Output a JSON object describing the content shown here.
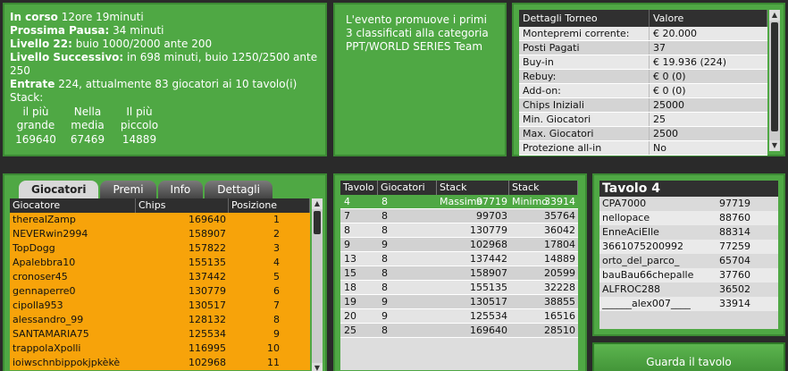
{
  "info": {
    "in_corso_label": "In corso",
    "in_corso_value": "12ore 19minuti",
    "pausa_label": "Prossima Pausa:",
    "pausa_value": "34 minuti",
    "livello_label": "Livello 22:",
    "livello_value": "buio 1000/2000 ante 200",
    "successivo_label": "Livello Successivo:",
    "successivo_value": "in 698 minuti, buio 1250/2500 ante 250",
    "entrate_label": "Entrate",
    "entrate_value": "224, attualmente 83 giocatori ai 10 tavolo(i)",
    "stack_label": "Stack:",
    "stacks": [
      {
        "l1": "il più",
        "l2": "grande",
        "value": "169640"
      },
      {
        "l1": "Nella",
        "l2": "media",
        "value": "67469"
      },
      {
        "l1": "Il più",
        "l2": "piccolo",
        "value": "14889"
      }
    ]
  },
  "promo": {
    "text": "L'evento promuove i primi 3 classificati alla categoria PPT/WORLD SERIES Team"
  },
  "details": {
    "headers": [
      "Dettagli Torneo",
      "Valore"
    ],
    "rows": [
      [
        "Montepremi corrente:",
        "€ 20.000"
      ],
      [
        "Posti Pagati",
        "37"
      ],
      [
        "Buy-in",
        "€ 19.936 (224)"
      ],
      [
        "Rebuy:",
        "€ 0 (0)"
      ],
      [
        "Add-on:",
        "€ 0 (0)"
      ],
      [
        "Chips Iniziali",
        "25000"
      ],
      [
        "Min. Giocatori",
        "25"
      ],
      [
        "Max. Giocatori",
        "2500"
      ],
      [
        "Protezione all-in",
        "No"
      ]
    ]
  },
  "players": {
    "tabs": [
      "Giocatori",
      "Premi",
      "Info",
      "Dettagli"
    ],
    "headers": [
      "Giocatore",
      "Chips",
      "Posizione"
    ],
    "rows": [
      [
        "therealZamp",
        "169640",
        "1"
      ],
      [
        "NEVERwin2994",
        "158907",
        "2"
      ],
      [
        "TopDogg",
        "157822",
        "3"
      ],
      [
        "Apalebbra10",
        "155135",
        "4"
      ],
      [
        "cronoser45",
        "137442",
        "5"
      ],
      [
        "gennaperre0",
        "130779",
        "6"
      ],
      [
        "cipolla953",
        "130517",
        "7"
      ],
      [
        "alessandro_99",
        "128132",
        "8"
      ],
      [
        "SANTAMARIA75",
        "125534",
        "9"
      ],
      [
        "trappolaXpolli",
        "116995",
        "10"
      ],
      [
        "ioiwschnbippokjpkèkè",
        "102968",
        "11"
      ]
    ]
  },
  "tables": {
    "headers": [
      "Tavolo",
      "Giocatori",
      "Stack Massimo",
      "Stack Minimo"
    ],
    "rows": [
      [
        "4",
        "8",
        "97719",
        "33914"
      ],
      [
        "7",
        "8",
        "99703",
        "35764"
      ],
      [
        "8",
        "8",
        "130779",
        "36042"
      ],
      [
        "9",
        "9",
        "102968",
        "17804"
      ],
      [
        "13",
        "8",
        "137442",
        "14889"
      ],
      [
        "15",
        "8",
        "158907",
        "20599"
      ],
      [
        "18",
        "8",
        "155135",
        "32228"
      ],
      [
        "19",
        "9",
        "130517",
        "38855"
      ],
      [
        "20",
        "9",
        "125534",
        "16516"
      ],
      [
        "25",
        "8",
        "169640",
        "28510"
      ]
    ]
  },
  "tavolo": {
    "title": "Tavolo 4",
    "rows": [
      [
        "CPA7000",
        "97719"
      ],
      [
        "nellopace",
        "88760"
      ],
      [
        "EnneAciElle",
        "88314"
      ],
      [
        "3661075200992",
        "77259"
      ],
      [
        "orto_del_parco_",
        "65704"
      ],
      [
        "bauBau66chepalle",
        "37760"
      ],
      [
        "ALFROC288",
        "36502"
      ],
      [
        "______alex007____",
        "33914"
      ]
    ],
    "watch_button": "Guarda il tavolo"
  }
}
